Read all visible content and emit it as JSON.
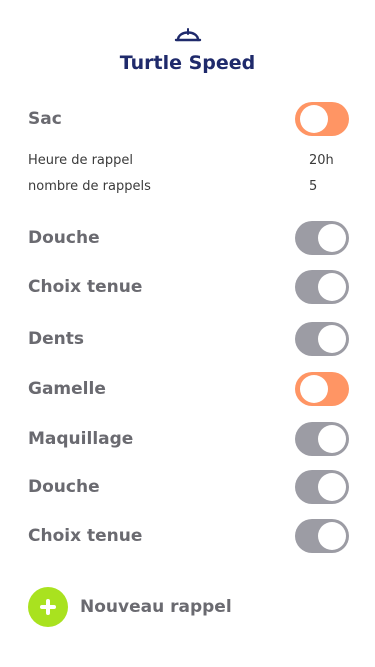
{
  "app": {
    "title": "Turtle Speed",
    "logo_icon": "turtle-shell-icon"
  },
  "main_toggle": {
    "label": "Sac",
    "on": true
  },
  "settings": [
    {
      "label": "Heure de rappel",
      "value": "20h"
    },
    {
      "label": "nombre de rappels",
      "value": "5"
    }
  ],
  "reminders": [
    {
      "label": "Douche",
      "on": false
    },
    {
      "label": "Choix tenue",
      "on": false
    },
    {
      "label": "Dents",
      "on": false
    },
    {
      "label": "Gamelle",
      "on": true
    },
    {
      "label": "Maquillage",
      "on": false
    },
    {
      "label": "Douche",
      "on": false
    },
    {
      "label": "Choix tenue",
      "on": false
    }
  ],
  "add_button": {
    "label": "Nouveau rappel",
    "icon": "plus-icon"
  },
  "colors": {
    "accent_on": "#ff9564",
    "toggle_off": "#9c9ca4",
    "add": "#a9e21f",
    "title": "#1f2a6b"
  }
}
